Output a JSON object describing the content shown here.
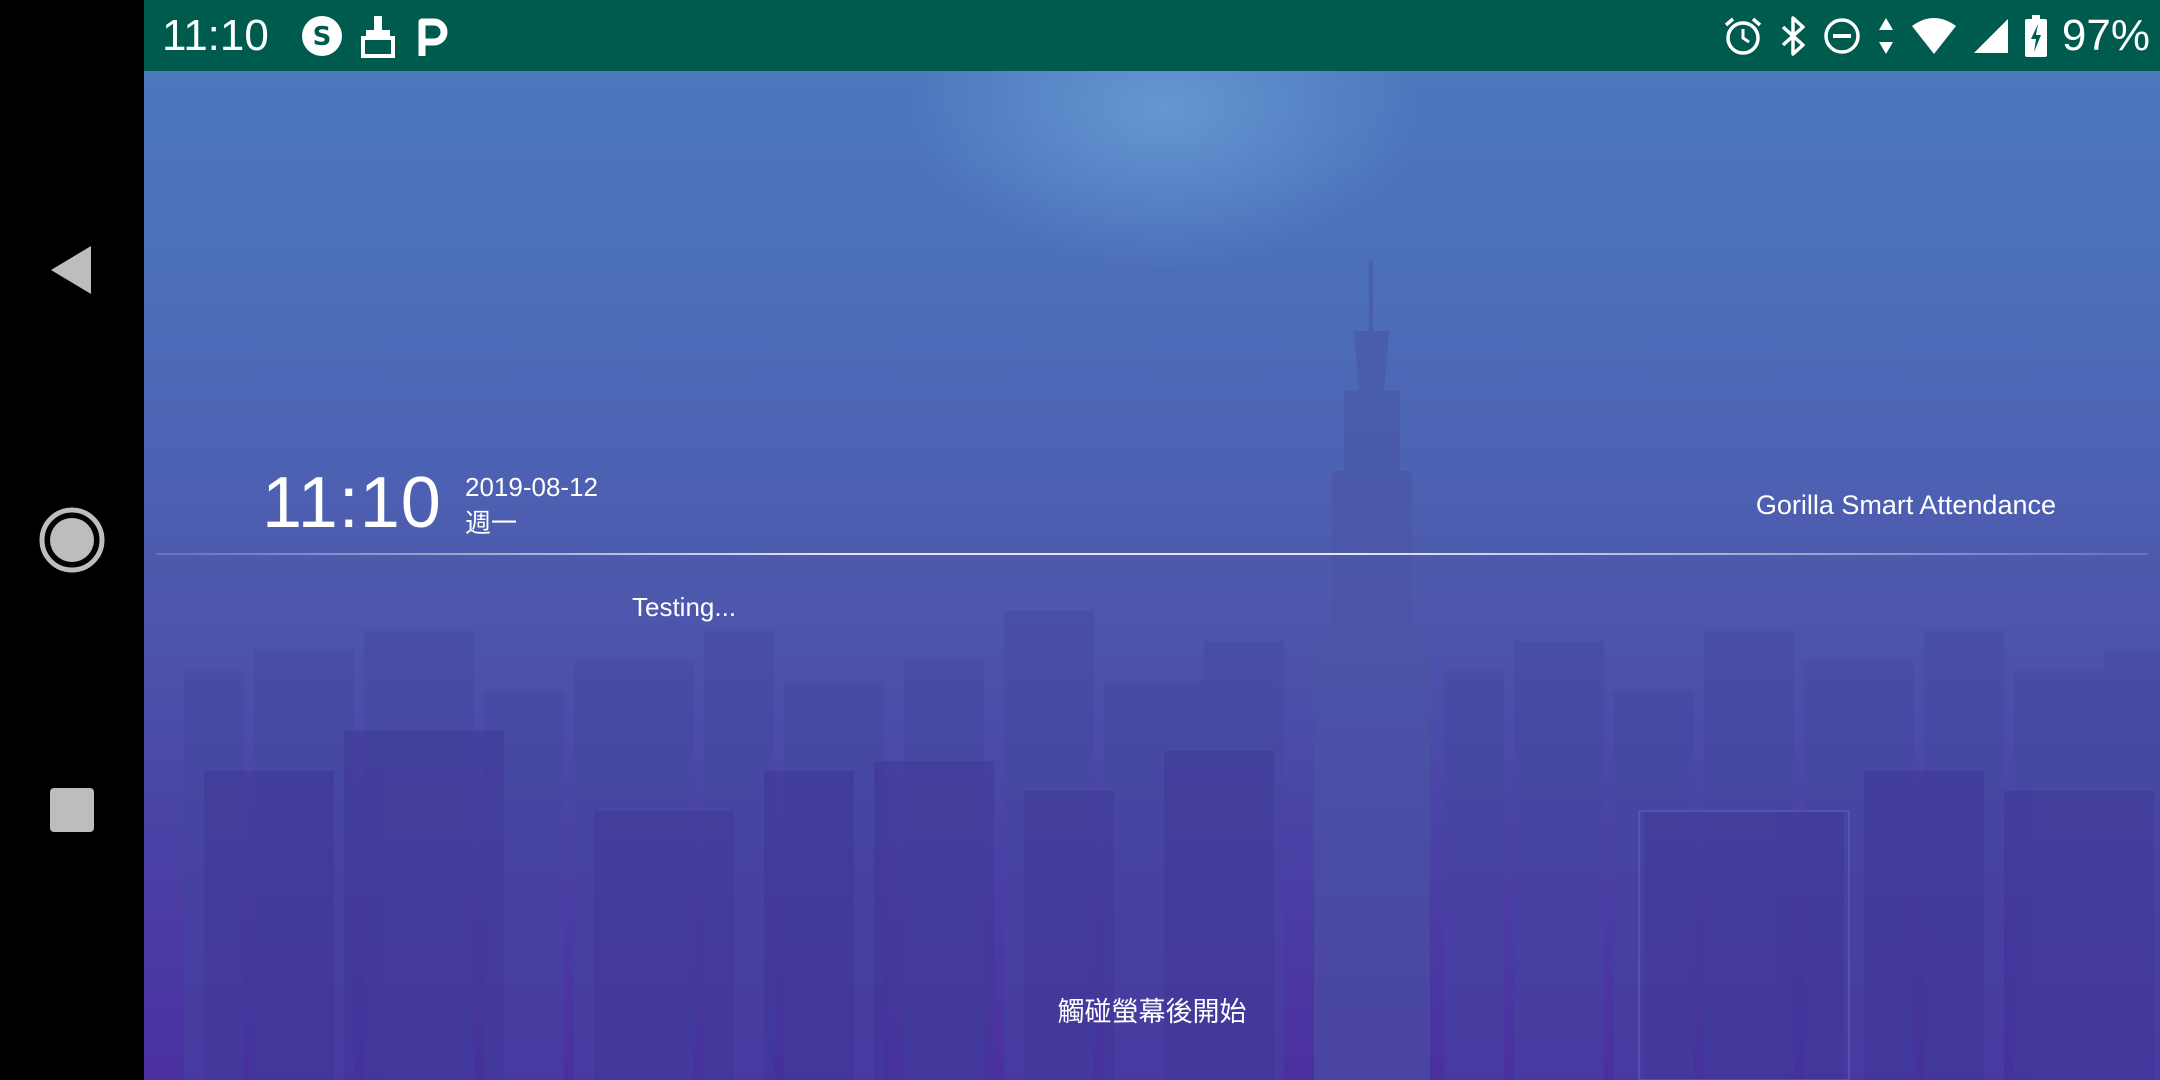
{
  "status_bar": {
    "time": "11:10",
    "left_icons": [
      "s-circle-icon",
      "cleaner-icon",
      "parking-icon"
    ],
    "right_icons": [
      "alarm-icon",
      "bluetooth-icon",
      "do-not-disturb-icon",
      "data-arrows-icon",
      "wifi-icon",
      "cell-signal-icon",
      "battery-charging-icon"
    ],
    "battery": "97%",
    "background_color": "#005b4f"
  },
  "nav_bar": {
    "items": [
      "back-icon",
      "home-icon",
      "recents-icon"
    ]
  },
  "screen": {
    "clock": {
      "time": "11:10",
      "date": "2019-08-12",
      "weekday": "週一"
    },
    "brand": "Gorilla Smart Attendance",
    "status_message": "Testing...",
    "hint": "觸碰螢幕後開始",
    "colors": {
      "gradient_top": "#4d78bd",
      "gradient_bottom": "#4b2fa0"
    }
  }
}
